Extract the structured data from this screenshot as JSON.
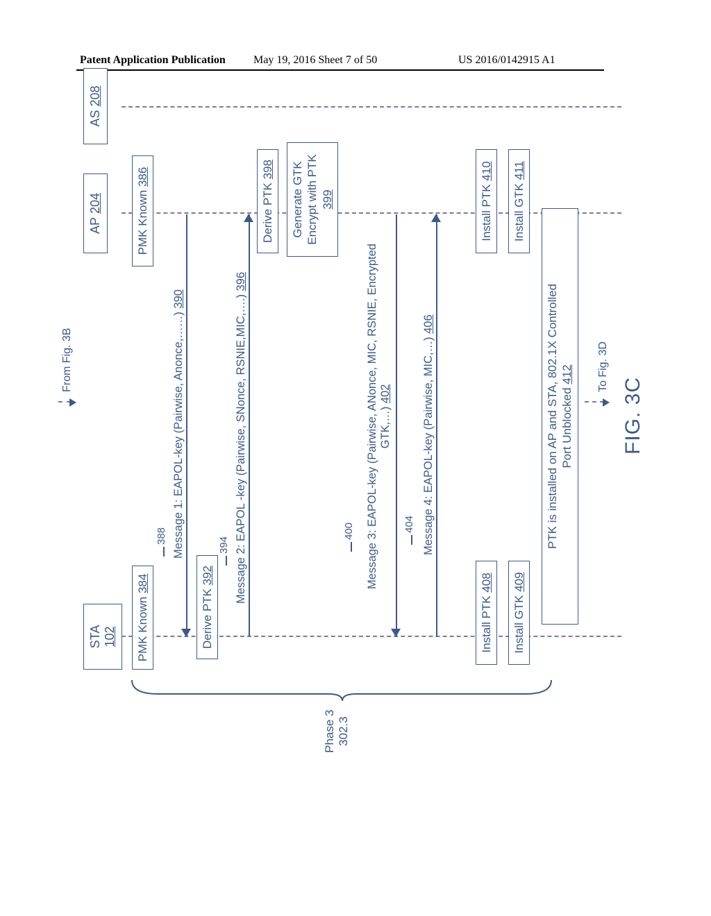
{
  "header": {
    "left": "Patent Application Publication",
    "mid": "May 19, 2016  Sheet 7 of 50",
    "right": "US 2016/0142915 A1"
  },
  "entities": {
    "sta_label": "STA",
    "sta_ref": "102",
    "ap_label": "AP",
    "ap_ref": "204",
    "as_label": "AS",
    "as_ref": "208"
  },
  "from_label": "From Fig. 3B",
  "to_label": "To Fig. 3D",
  "boxes": {
    "pmk_known_sta": "PMK Known",
    "pmk_known_sta_ref": "384",
    "pmk_known_ap": "PMK Known",
    "pmk_known_ap_ref": "386",
    "derive_ptk_sta": "Derive PTK",
    "derive_ptk_sta_ref": "392",
    "derive_ptk_ap": "Derive PTK",
    "derive_ptk_ap_ref": "398",
    "gen_gtk_line1": "Generate GTK",
    "gen_gtk_line2": "Encrypt with PTK",
    "gen_gtk_ref": "399",
    "install_ptk_sta": "Install PTK",
    "install_ptk_sta_ref": "408",
    "install_gtk_sta": "Install GTK",
    "install_gtk_sta_ref": "409",
    "install_ptk_ap": "Install PTK",
    "install_ptk_ap_ref": "410",
    "install_gtk_ap": "Install GTK",
    "install_gtk_ap_ref": "411",
    "final_line1": "PTK is installed on AP and STA, 802.1X Controlled",
    "final_line2": "Port Unblocked",
    "final_ref": "412"
  },
  "ticks": {
    "m1_tick": "388",
    "m2_tick": "394",
    "m3_tick": "400",
    "m4_tick": "404"
  },
  "messages": {
    "m1_label": "Message 1: EAPOL-key (Pairwise, Anonce,……)",
    "m1_ref": "390",
    "m2_label": "Message 2: EAPOL -key (Pairwise, SNonce, RSNIE,MIC,….)",
    "m2_ref": "396",
    "m3_line1": "Message 3: EAPOL-key (Pairwise, ANonce, MIC, RSNIE, Encrypted",
    "m3_line2": "GTK,…)",
    "m3_ref": "402",
    "m4_label": "Message 4: EAPOL-key (Pairwise, MIC,…)",
    "m4_ref": "406"
  },
  "phase": {
    "line1": "Phase 3",
    "line2": "302.3"
  },
  "figure": "FIG. 3C"
}
